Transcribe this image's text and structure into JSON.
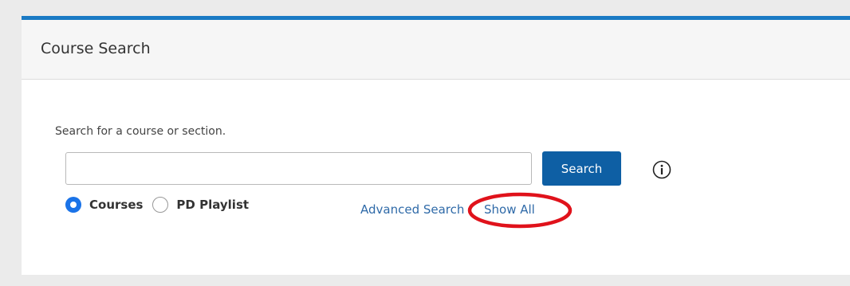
{
  "panel": {
    "title": "Course Search",
    "accent_color": "#1a7ac4"
  },
  "search": {
    "instruction": "Search for a course or section.",
    "input_value": "",
    "placeholder": "",
    "button_label": "Search",
    "button_color": "#0e5fa4",
    "info_icon": "info-circle-icon"
  },
  "search_type": {
    "options": [
      {
        "label": "Courses",
        "selected": true
      },
      {
        "label": "PD Playlist",
        "selected": false
      }
    ]
  },
  "links": {
    "advanced_search": "Advanced Search",
    "show_all": "Show All"
  },
  "annotation": {
    "shape": "ellipse",
    "color": "#e0121b",
    "target": "Show All"
  }
}
